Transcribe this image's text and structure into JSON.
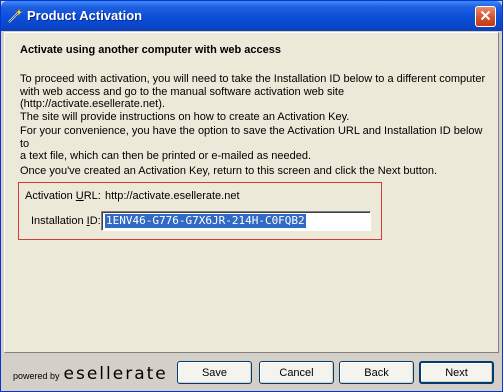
{
  "window": {
    "title": "Product Activation"
  },
  "main": {
    "heading": "Activate using another computer with web access",
    "paragraph1": "To proceed with activation, you will need to take the Installation ID below to a different computer\nwith web access and go to the manual software activation web site (http://activate.esellerate.net).\nThe site will provide instructions on how to create an Activation Key.",
    "paragraph2": "For your convenience, you have the option to save the Activation URL and Installation ID below to\na text file, which can then be printed or e-mailed as needed.",
    "paragraph3": "Once you've created an Activation Key, return to this screen and click the Next button.",
    "activation_url": {
      "label_prefix": "Activation ",
      "label_underlined": "U",
      "label_suffix": "RL:",
      "value": "http://activate.esellerate.net"
    },
    "installation_id": {
      "label_prefix": "Installation ",
      "label_underlined": "I",
      "label_suffix": "D:",
      "value": "1ENV46-G776-G7X6JR-214H-C0FQB2"
    }
  },
  "footer": {
    "powered_by": "powered by",
    "brand": "esellerate",
    "buttons": {
      "save": "Save",
      "cancel": "Cancel",
      "back": "Back",
      "next": "Next"
    }
  },
  "colors": {
    "titlebar": "#0a4fd8",
    "highlight_border": "#d23c3c",
    "selection": "#316ac5"
  },
  "icons": {
    "app": "wand-icon",
    "close": "close-icon"
  }
}
